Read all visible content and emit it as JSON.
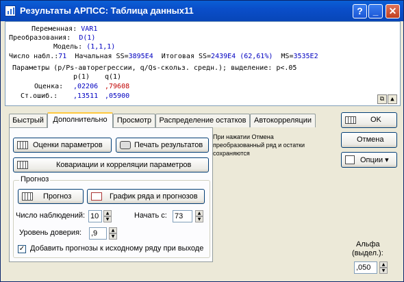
{
  "window": {
    "title": "Результаты АРПСС: Таблица данных11",
    "help_label": "?",
    "minimize_label": "_",
    "maximize_label": "□",
    "close_label": "✕"
  },
  "results": {
    "line1_label": "Переменная:",
    "line1_value": "VAR1",
    "line2_label": "Преобразования:",
    "line2_value": "D(1)",
    "line3_label": "Модель:",
    "line3_value": "(1,1,1)",
    "line4_a": "Число набл.:",
    "line4_a_val": "71",
    "line4_b": "Начальная SS=",
    "line4_b_val": "3895E4",
    "line4_c": "Итоговая SS=",
    "line4_c_val": "2439E4 (62,61%)",
    "line4_d": "MS=",
    "line4_d_val": "3535E2",
    "line5": "Параметры (p/Ps-авторегрессии, q/Qs-скольз. средн.); выделение: p<.05",
    "col_headers": [
      "p(1)",
      "q(1)"
    ],
    "row1_label": "Оценка:",
    "row1_values": [
      ",02206",
      ",79608"
    ],
    "row2_label": "Ст.ошиб.:",
    "row2_values": [
      ",13511",
      ",05900"
    ]
  },
  "tabs": [
    "Быстрый",
    "Дополнительно",
    "Просмотр",
    "Распределение остатков",
    "Автокорреляции"
  ],
  "active_tab": "Дополнительно",
  "panel": {
    "estimates_button": "Оценки параметров",
    "print_button": "Печать результатов",
    "covariance_button": "Ковариации и корреляции параметров",
    "note": "При нажатии Отмена преобразованный ряд и остатки сохраняются",
    "forecast_group": "Прогноз",
    "forecast_button": "Прогноз",
    "plot_button": "График ряда и прогнозов",
    "obs_label": "Число наблюдений:",
    "obs_value": "10",
    "start_label": "Начать с:",
    "start_value": "73",
    "confidence_label": "Уровень доверия:",
    "confidence_value": ",9",
    "append_checkbox_label": "Добавить прогнозы к исходному ряду при выходе",
    "append_checked": true,
    "check_mark": "✓"
  },
  "side": {
    "ok_button": "OK",
    "cancel_button": "Отмена",
    "options_button": "Опции ▾",
    "alpha_label_line1": "Альфа",
    "alpha_label_line2": "(выдел.):",
    "alpha_value": ",050"
  }
}
